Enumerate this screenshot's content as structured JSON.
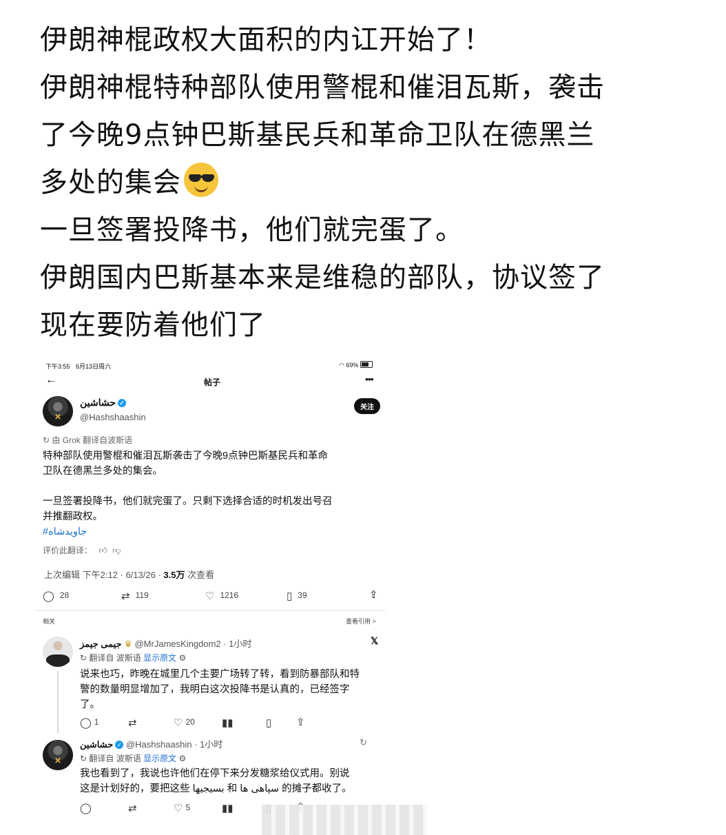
{
  "caption": {
    "lines": [
      "伊朗神棍政权大面积的内讧开始了！",
      "伊朗神棍特种部队使用警棍和催泪瓦斯，袭击",
      "了今晚9点钟巴斯基民兵和革命卫队在德黑兰",
      "多处的集会",
      "一旦签署投降书，他们就完蛋了。",
      "伊朗国内巴斯基本来是维稳的部队，协议签了",
      "现在要防着他们了"
    ],
    "emoji": "sunglasses-emoji"
  },
  "status_bar": {
    "time": "下午3:55",
    "date": "6月13日周六",
    "battery": "69%"
  },
  "nav": {
    "title": "帖子"
  },
  "post": {
    "display_name": "حشاشين",
    "handle": "@Hashshaashin",
    "follow_label": "关注",
    "translated_by": "由 Grok 翻译自波斯语",
    "text_p1_line1": "特种部队使用警棍和催泪瓦斯袭击了今晚9点钟巴斯基民兵和革命",
    "text_p1_line2": "卫队在德黑兰多处的集会。",
    "text_p2_line1": "一旦签署投降书，他们就完蛋了。只剩下选择合适的时机发出号召",
    "text_p2_line2": "并推翻政权。",
    "hashtag": "#جاویدشاه",
    "rate_translation": "评价此翻译：",
    "meta_prefix": "上次编辑 下午2:12 · 6/13/26 · ",
    "views": "3.5万",
    "views_suffix": " 次查看",
    "stats": {
      "replies": "28",
      "reposts": "119",
      "likes": "1216",
      "bookmarks": "39"
    }
  },
  "replies_header": {
    "left": "相关",
    "right": "查看引用 >"
  },
  "reply1": {
    "display_name": "جیمی جیمز",
    "handle_time": "@MrJamesKingdom2 · 1小时",
    "translated": "翻译自 波斯语",
    "show_original": "显示原文",
    "line1": "说来也巧，昨晚在城里几个主要广场转了转，看到防暴部队和特",
    "line2": "警的数量明显增加了，我明白这次投降书是认真的，已经签字",
    "line3": "了。",
    "stats": {
      "replies": "1",
      "likes": "20"
    }
  },
  "reply2": {
    "display_name": "حشاشين",
    "handle_time": "@Hashshaashin · 1小时",
    "translated": "翻译自 波斯语",
    "show_original": "显示原文",
    "line1": "我也看到了，我说也许他们在停下来分发糖浆给仪式用。别说",
    "line2": "这是计划好的，要把这些 بسیجیها 和 سپاهی ها 的摊子都收了。",
    "stats": {
      "likes": "5"
    }
  }
}
